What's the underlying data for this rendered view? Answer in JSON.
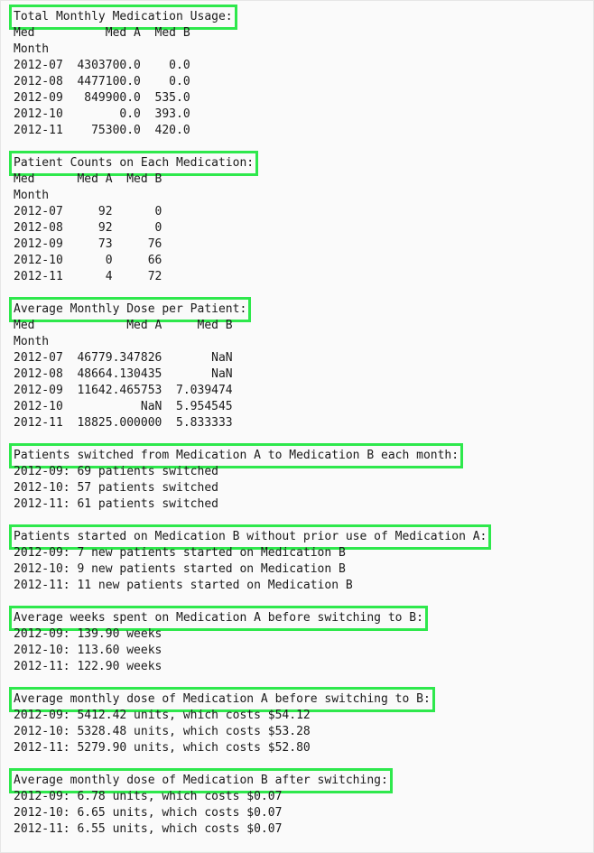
{
  "colors": {
    "highlight_box": "#2ee84c",
    "text": "#1a1a1a",
    "background": "#fafafa"
  },
  "sections": [
    {
      "title": "Total Monthly Medication Usage:",
      "lines": [
        "Med          Med A  Med B",
        "Month",
        "2012-07  4303700.0    0.0",
        "2012-08  4477100.0    0.0",
        "2012-09   849900.0  535.0",
        "2012-10        0.0  393.0",
        "2012-11    75300.0  420.0"
      ]
    },
    {
      "title": "Patient Counts on Each Medication:",
      "lines": [
        "Med      Med A  Med B",
        "Month",
        "2012-07     92      0",
        "2012-08     92      0",
        "2012-09     73     76",
        "2012-10      0     66",
        "2012-11      4     72"
      ]
    },
    {
      "title": "Average Monthly Dose per Patient:",
      "lines": [
        "Med             Med A     Med B",
        "Month",
        "2012-07  46779.347826       NaN",
        "2012-08  48664.130435       NaN",
        "2012-09  11642.465753  7.039474",
        "2012-10           NaN  5.954545",
        "2012-11  18825.000000  5.833333"
      ]
    },
    {
      "title": "Patients switched from Medication A to Medication B each month:",
      "lines": [
        "2012-09: 69 patients switched",
        "2012-10: 57 patients switched",
        "2012-11: 61 patients switched"
      ]
    },
    {
      "title": "Patients started on Medication B without prior use of Medication A:",
      "lines": [
        "2012-09: 7 new patients started on Medication B",
        "2012-10: 9 new patients started on Medication B",
        "2012-11: 11 new patients started on Medication B"
      ]
    },
    {
      "title": "Average weeks spent on Medication A before switching to B:",
      "lines": [
        "2012-09: 139.90 weeks",
        "2012-10: 113.60 weeks",
        "2012-11: 122.90 weeks"
      ]
    },
    {
      "title": "Average monthly dose of Medication A before switching to B:",
      "lines": [
        "2012-09: 5412.42 units, which costs $54.12",
        "2012-10: 5328.48 units, which costs $53.28",
        "2012-11: 5279.90 units, which costs $52.80"
      ]
    },
    {
      "title": "Average monthly dose of Medication B after switching:",
      "lines": [
        "2012-09: 6.78 units, which costs $0.07",
        "2012-10: 6.65 units, which costs $0.07",
        "2012-11: 6.55 units, which costs $0.07"
      ]
    }
  ]
}
